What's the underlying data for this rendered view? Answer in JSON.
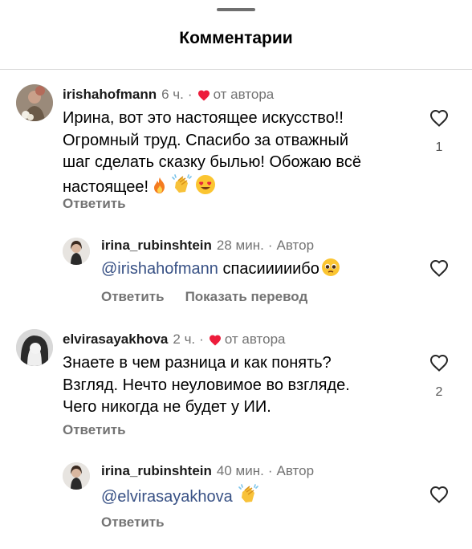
{
  "sheet": {
    "title": "Комментарии"
  },
  "comments": [
    {
      "username": "irishahofmann",
      "time": "6 ч.",
      "sep": "·",
      "from_author": "от автора",
      "lines": [
        "Ирина, вот это настоящее искусство!!",
        "Огромный труд. Спасибо за  отважный",
        "шаг сделать сказку былью! Обожаю всё",
        "настоящее!"
      ],
      "emojis": [
        "fire",
        "clapping-hands",
        "heart-eyes"
      ],
      "reply_label": "Ответить",
      "like_count": "1"
    },
    {
      "username": "irina_rubinshtein",
      "time": "28 мин.",
      "sep": "·",
      "author_label": "Автор",
      "mention": "@irishahofmann",
      "text": " спасииииибо",
      "emojis": [
        "pleading-face"
      ],
      "reply_label": "Ответить",
      "translate_label": "Показать перевод"
    },
    {
      "username": "elvirasayakhova",
      "time": "2 ч.",
      "sep": "·",
      "from_author": "от автора",
      "lines": [
        "Знаете в чем разница и как понять?",
        "Взгляд. Нечто неуловимое во взгляде.",
        "Чего никогда не будет у ИИ."
      ],
      "reply_label": "Ответить",
      "like_count": "2"
    },
    {
      "username": "irina_rubinshtein",
      "time": "40 мин.",
      "sep": "·",
      "author_label": "Автор",
      "mention": "@elvirasayakhova",
      "emojis": [
        "clapping-hands"
      ],
      "reply_label": "Ответить"
    }
  ],
  "colors": {
    "author_heart": "#ed1c3b",
    "mention": "#385185",
    "secondary": "#737373"
  }
}
